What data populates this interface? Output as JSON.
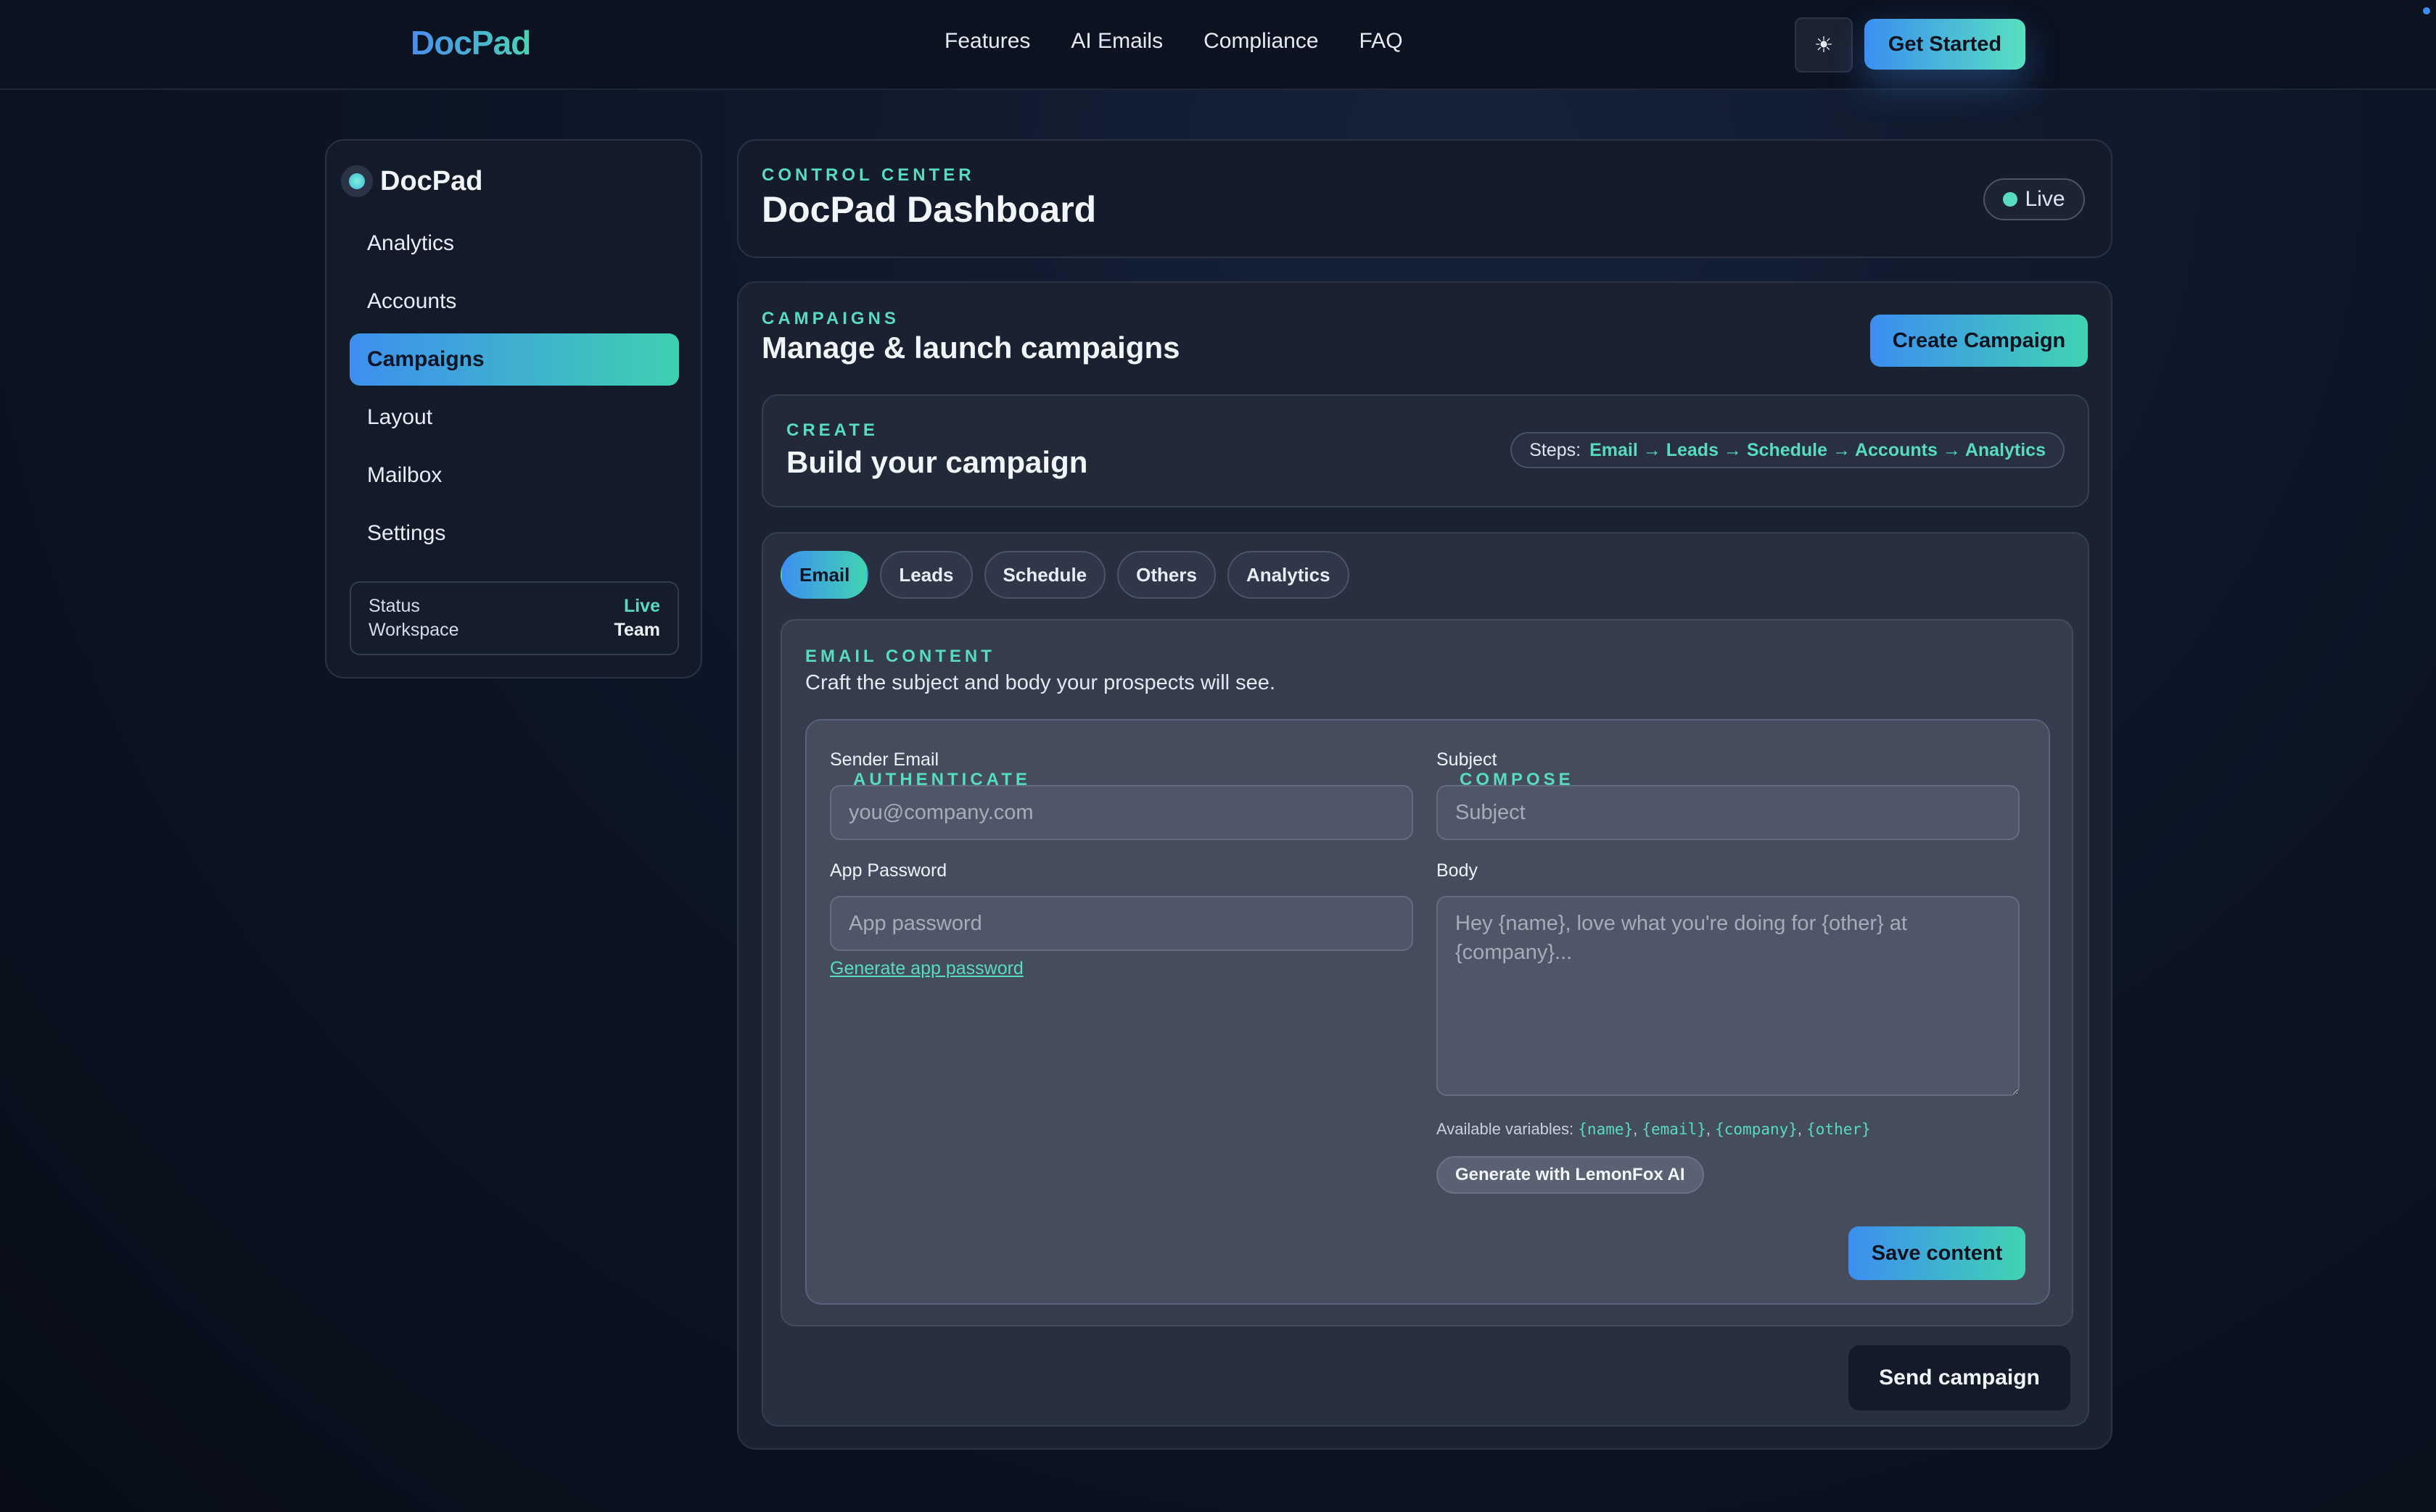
{
  "nav": {
    "brand": "DocPad",
    "links": [
      "Features",
      "AI Emails",
      "Compliance",
      "FAQ"
    ],
    "theme_icon": "☀",
    "cta": "Get Started"
  },
  "sidebar": {
    "brand": "DocPad",
    "items": [
      {
        "label": "Analytics",
        "active": false
      },
      {
        "label": "Accounts",
        "active": false
      },
      {
        "label": "Campaigns",
        "active": true
      },
      {
        "label": "Layout",
        "active": false
      },
      {
        "label": "Mailbox",
        "active": false
      },
      {
        "label": "Settings",
        "active": false
      }
    ],
    "status": {
      "status_label": "Status",
      "status_value": "Live",
      "workspace_label": "Workspace",
      "workspace_value": "Team"
    }
  },
  "header": {
    "eyebrow": "CONTROL CENTER",
    "title": "DocPad Dashboard",
    "badge": "Live"
  },
  "campaigns": {
    "eyebrow": "CAMPAIGNS",
    "title": "Manage & launch campaigns",
    "create_button": "Create Campaign",
    "build": {
      "eyebrow": "CREATE",
      "title": "Build your campaign",
      "steps_label": "Steps:",
      "steps_sequence": "Email → Leads → Schedule → Accounts → Analytics"
    },
    "tabs": [
      {
        "label": "Email",
        "active": true
      },
      {
        "label": "Leads",
        "active": false
      },
      {
        "label": "Schedule",
        "active": false
      },
      {
        "label": "Others",
        "active": false
      },
      {
        "label": "Analytics",
        "active": false
      }
    ],
    "email_content": {
      "eyebrow": "EMAIL CONTENT",
      "description": "Craft the subject and body your prospects will see.",
      "authenticate": {
        "eyebrow": "AUTHENTICATE",
        "sender_label": "Sender Email",
        "sender_placeholder": "you@company.com",
        "password_label": "App Password",
        "password_placeholder": "App password",
        "generate_link": "Generate app password"
      },
      "compose": {
        "eyebrow": "COMPOSE",
        "subject_label": "Subject",
        "subject_placeholder": "Subject",
        "body_label": "Body",
        "body_placeholder": "Hey {name}, love what you're doing for {other} at {company}...",
        "variables_label": "Available variables:",
        "variables": [
          "{name}",
          "{email}",
          "{company}",
          "{other}"
        ],
        "generate_button": "Generate with LemonFox AI",
        "save_button": "Save content"
      }
    },
    "send_button": "Send campaign"
  }
}
